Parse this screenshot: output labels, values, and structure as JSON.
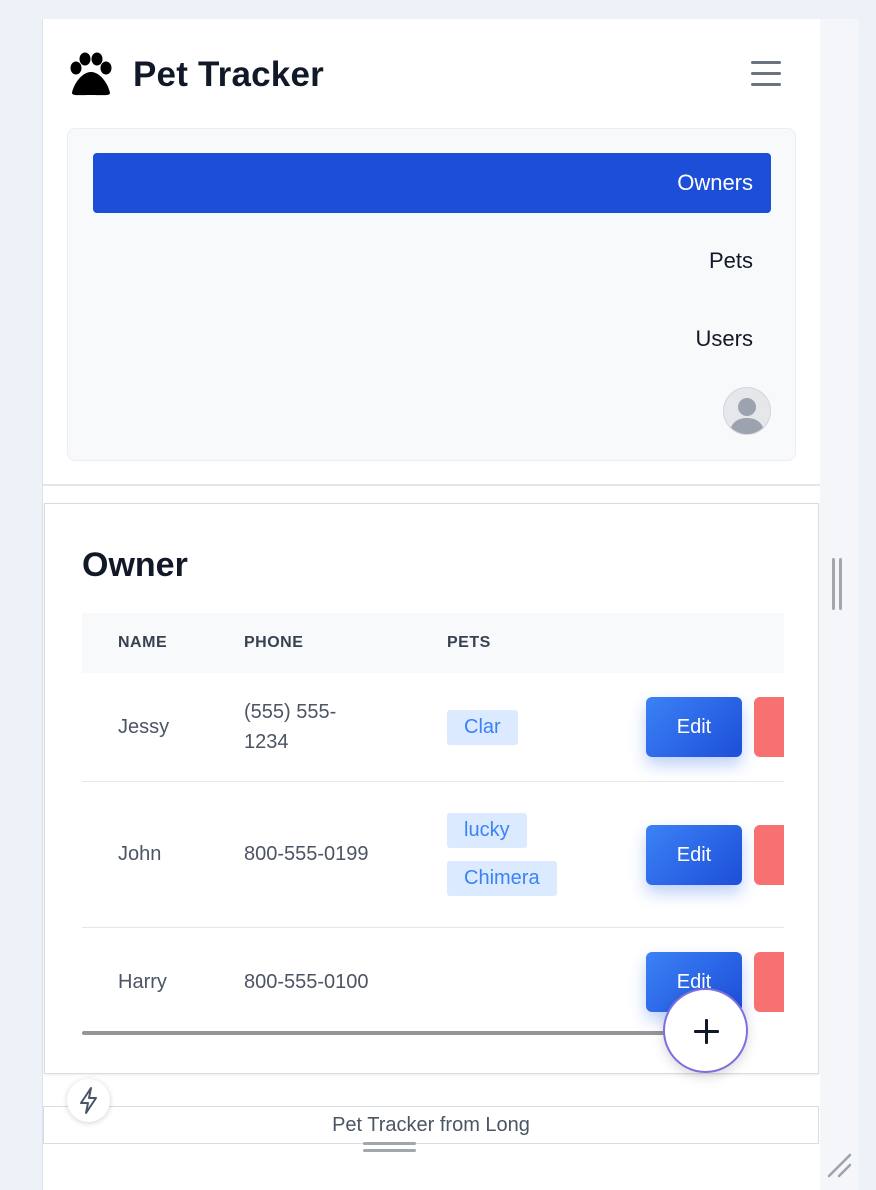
{
  "header": {
    "title": "Pet Tracker",
    "logo_icon": "paw-icon",
    "menu_icon": "hamburger-menu-icon"
  },
  "nav": {
    "items": [
      {
        "label": "Owners",
        "active": true
      },
      {
        "label": "Pets",
        "active": false
      },
      {
        "label": "Users",
        "active": false
      }
    ],
    "avatar_icon": "user-avatar-icon"
  },
  "owners": {
    "title": "Owner",
    "columns": [
      "NAME",
      "PHONE",
      "PETS"
    ],
    "rows": [
      {
        "name": "Jessy",
        "phone_line1": "(555) 555-",
        "phone_line2": "1234",
        "pets": [
          "Clar"
        ],
        "edit_label": "Edit"
      },
      {
        "name": "John",
        "phone": "800-555-0199",
        "pets": [
          "lucky",
          "Chimera"
        ],
        "edit_label": "Edit"
      },
      {
        "name": "Harry",
        "phone": "800-555-0100",
        "pets": [],
        "edit_label": "Edit"
      }
    ]
  },
  "fab": {
    "icon": "plus-icon"
  },
  "flash": {
    "icon": "lightning-icon"
  },
  "footer": {
    "text": "Pet Tracker from Long"
  },
  "colors": {
    "primary": "#1d4ed8",
    "accent": "#3b82f6",
    "badge_bg": "#dbeafe",
    "danger": "#f87171",
    "background": "#edf1f8"
  }
}
